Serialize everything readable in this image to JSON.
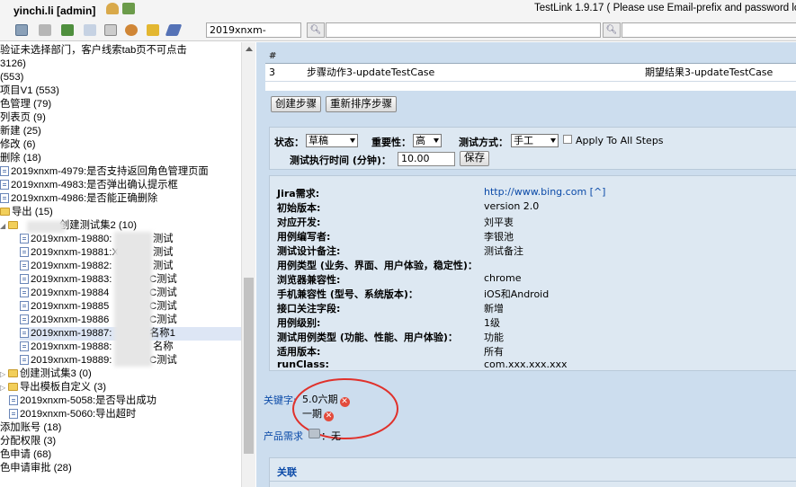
{
  "header": {
    "user": "yinchi.li [admin]",
    "app_title": "TestLink 1.9.17 ( Please use Email-prefix and password lo",
    "project": "2019xnxm-",
    "colors": {
      "accent": "#ccddee",
      "link": "#0b4aa8",
      "error": "#e34b3c"
    }
  },
  "tree": {
    "rows": [
      "验证未选择部门，客户线索tab页不可点击",
      "3126)",
      "(553)",
      "项目V1 (553)",
      "色管理 (79)",
      "列表页 (9)",
      "新建 (25)",
      "修改 (6)",
      "删除 (18)",
      "2019xnxm-4979:是否支持返回角色管理页面",
      "2019xnxm-4983:是否弹出确认提示框",
      "2019xnxm-4986:是否能正确删除",
      "导出 (15)",
      "创建测试集2 (10)",
      "2019xnxm-19880:",
      "测试",
      "2019xnxm-19881:X",
      "测试",
      "2019xnxm-19882:",
      "测试",
      "2019xnxm-19883:",
      "C测试",
      "2019xnxm-19884",
      "C测试",
      "2019xnxm-19885",
      "C测试",
      "2019xnxm-19886",
      "C测试",
      "2019xnxm-19887:",
      "名称1",
      "2019xnxm-19888:",
      "名称",
      "2019xnxm-19889:",
      "C测试",
      "创建测试集3 (0)",
      "导出模板自定义 (3)",
      "2019xnxm-5058:是否导出成功",
      "2019xnxm-5060:导出超时",
      "添加账号 (18)",
      "分配权限 (3)",
      "色申请 (68)",
      "色申请审批 (28)"
    ]
  },
  "steps": {
    "col_num": "#",
    "row_num": "3",
    "action": "步骤动作3-updateTestCase",
    "expected": "期望结果3-updateTestCase",
    "create_step": "创建步骤",
    "reorder_steps": "重新排序步骤"
  },
  "status_bar": {
    "status_label": "状态：",
    "status_value": "草稿",
    "importance_label": "重要性：",
    "importance_value": "高",
    "exec_type_label": "测试方式：",
    "exec_type_value": "手工",
    "apply_all": "Apply To All Steps",
    "exec_time_label": "测试执行时间 (分钟)：",
    "exec_time_value": "10.00",
    "save": "保存"
  },
  "custom_fields": [
    {
      "label": "Jira需求:",
      "value": "http://www.bing.com [^]"
    },
    {
      "label": "初始版本:",
      "value": "version 2.0"
    },
    {
      "label": "对应开发:",
      "value": "刘平衷"
    },
    {
      "label": "用例编写者:",
      "value": "李银池"
    },
    {
      "label": "测试设计备注:",
      "value": "测试备注"
    },
    {
      "label": "用例类型 (业务、界面、用户体验，稳定性)：",
      "value": ""
    },
    {
      "label": "浏览器兼容性:",
      "value": "chrome"
    },
    {
      "label": "手机兼容性 (型号、系统版本)：",
      "value": "iOS和Android"
    },
    {
      "label": "接口关注字段:",
      "value": "新增"
    },
    {
      "label": "用例级别:",
      "value": "1级"
    },
    {
      "label": "测试用例类型 (功能、性能、用户体验)：",
      "value": "功能"
    },
    {
      "label": "适用版本:",
      "value": "所有"
    },
    {
      "label": "runClass:",
      "value": "com.xxx.xxx.xxx"
    }
  ],
  "keywords": {
    "label": "关键字:",
    "items": [
      "5.0六期",
      "一期"
    ],
    "remove_glyph": "✕"
  },
  "requirements": {
    "label": "产品需求",
    "value": "：无"
  },
  "relations": {
    "label": "关联"
  }
}
